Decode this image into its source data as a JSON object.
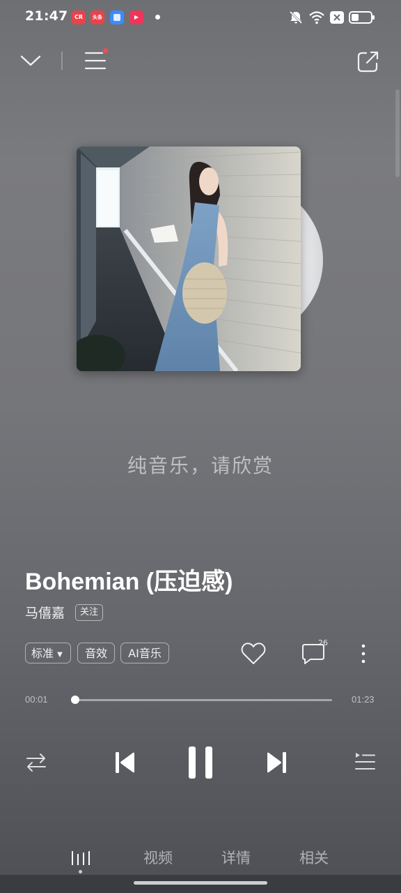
{
  "status_bar": {
    "time": "21:47",
    "apps": [
      {
        "name": "cr-app-icon",
        "label": "CR",
        "color": "#e8434c"
      },
      {
        "name": "toutiao-app-icon",
        "label": "头条",
        "color": "#e8434c"
      },
      {
        "name": "blue-app-icon",
        "label": "",
        "color": "#3d8bff"
      },
      {
        "name": "video-app-icon",
        "label": "▶",
        "color": "#f0355a"
      }
    ],
    "icons": [
      "bell-muted-icon",
      "wifi-icon",
      "close-box-icon",
      "battery-icon"
    ]
  },
  "toolbar": {
    "icons": [
      "chevron-down-icon",
      "menu-icon",
      "share-icon"
    ],
    "menu_has_notification": true
  },
  "album": {
    "artwork": "album-cover-photo",
    "disc": "vinyl-disc"
  },
  "lyric_hint": "纯音乐，请欣赏",
  "song": {
    "title": "Bohemian (压迫感)",
    "artist": "马僖嘉",
    "follow_label": "关注"
  },
  "actions": {
    "quality_label": "标准",
    "effects_label": "音效",
    "ai_label": "AI音乐",
    "comment_count": "26",
    "icons": [
      "heart-icon",
      "comment-icon",
      "more-vertical-icon"
    ]
  },
  "progress": {
    "current": "00:01",
    "total": "01:23",
    "fraction": 0.012
  },
  "controls": {
    "icons": [
      "repeat-icon",
      "previous-icon",
      "pause-icon",
      "next-icon",
      "playlist-icon"
    ]
  },
  "tabs": {
    "items": [
      "视频",
      "详情",
      "相关"
    ],
    "active_icon": "lyrics-bars-icon"
  },
  "colors": {
    "accent_dot": "#f24b5a"
  }
}
